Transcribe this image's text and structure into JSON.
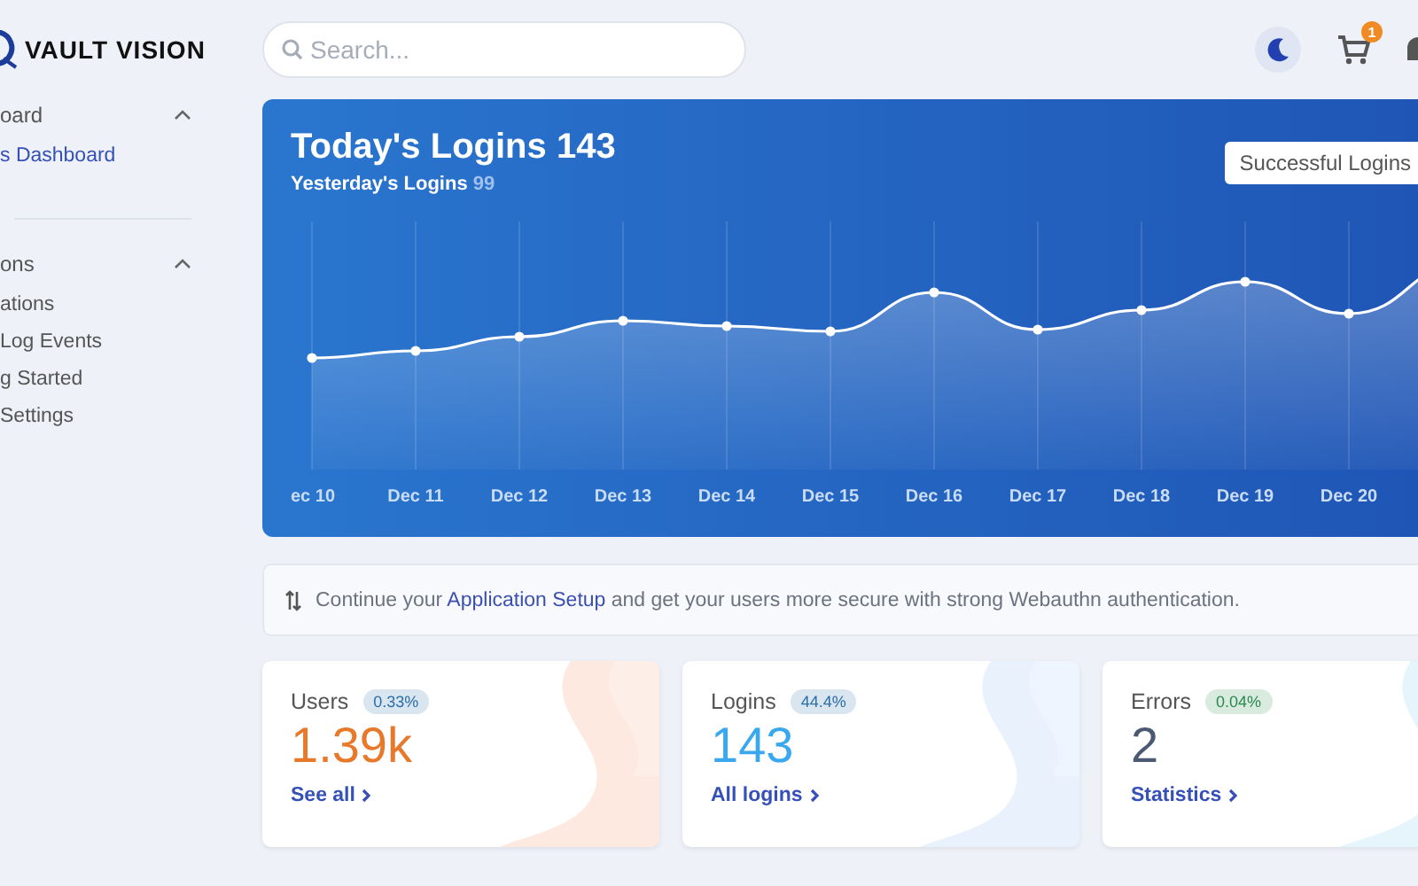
{
  "logo": {
    "text": "VAULT VISION"
  },
  "search": {
    "placeholder": "Search..."
  },
  "header_icons": {
    "cart_badge": "1"
  },
  "sidebar": {
    "sections": [
      {
        "label": "oard",
        "expanded": true,
        "children": [
          {
            "label": "s Dashboard",
            "selected": true
          }
        ]
      },
      {
        "label": "ons",
        "expanded": true,
        "children": [
          {
            "label": "ations",
            "selected": false
          },
          {
            "label": "Log Events",
            "selected": false
          },
          {
            "label": "g Started",
            "selected": false
          },
          {
            "label": "Settings",
            "selected": false
          }
        ]
      }
    ]
  },
  "login_chart": {
    "title": "Today's Logins 143",
    "subtitle_label": "Yesterday's Logins",
    "subtitle_value": "99",
    "filter": "Successful Logins",
    "x_labels": [
      "ec 10",
      "Dec 11",
      "Dec 12",
      "Dec 13",
      "Dec 14",
      "Dec 15",
      "Dec 16",
      "Dec 17",
      "Dec 18",
      "Dec 19",
      "Dec 20"
    ]
  },
  "banner": {
    "text_before": "Continue your",
    "link": "Application Setup",
    "text_after": "and get your users more secure with strong Webauthn authentication."
  },
  "stats": [
    {
      "label": "Users",
      "trend": {
        "text": "0.33%",
        "color": "#2a6fa8"
      },
      "value": "1.39k",
      "color": "#e8792b",
      "link": "See all"
    },
    {
      "label": "Logins",
      "trend": {
        "text": "44.4%",
        "color": "#2a6fa8"
      },
      "value": "143",
      "color": "#3aa8ee",
      "link": "All logins"
    },
    {
      "label": "Errors",
      "trend": {
        "text": "0.04%",
        "color": "#2b8a4e"
      },
      "value": "2",
      "color": "#4b5a72",
      "link": "Statistics"
    }
  ]
}
